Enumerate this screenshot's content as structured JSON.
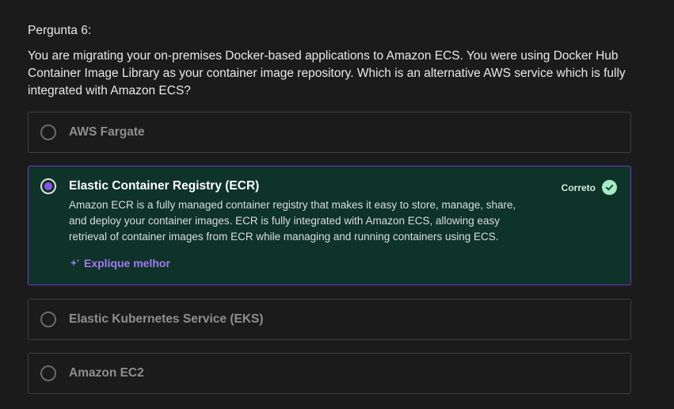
{
  "question": {
    "label": "Pergunta 6:",
    "text": "You are migrating your on-premises Docker-based applications to Amazon ECS. You were using Docker Hub Container Image Library as your container image repository. Which is an alternative AWS service which is fully integrated with Amazon ECS?"
  },
  "options": [
    {
      "title": "AWS Fargate",
      "selected": false
    },
    {
      "title": "Elastic Container Registry (ECR)",
      "selected": true,
      "explanation": "Amazon ECR is a fully managed container registry that makes it easy to store, manage, share, and deploy your container images. ECR is fully integrated with Amazon ECS, allowing easy retrieval of container images from ECR while managing and running containers using ECS.",
      "badge": "Correto",
      "explain_link": "Explique melhor"
    },
    {
      "title": "Elastic Kubernetes Service (EKS)",
      "selected": false
    },
    {
      "title": "Amazon EC2",
      "selected": false
    }
  ],
  "colors": {
    "background": "#1b1b1b",
    "selected_bg": "#0e3328",
    "selected_border": "#6d38d6",
    "accent_purple": "#a478f5",
    "correct_green": "#a6ecc7"
  },
  "icons": {
    "check": "check-circle-icon",
    "sparkle": "sparkle-icon"
  }
}
